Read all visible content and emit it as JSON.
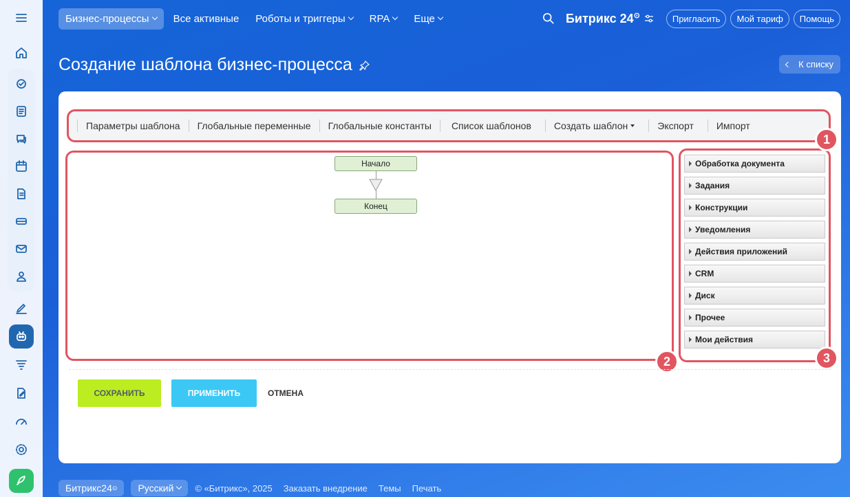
{
  "nav": {
    "items": [
      {
        "label": "Бизнес-процессы",
        "active": true,
        "dropdown": true
      },
      {
        "label": "Все активные",
        "active": false,
        "dropdown": false
      },
      {
        "label": "Роботы и триггеры",
        "active": false,
        "dropdown": true
      },
      {
        "label": "RPA",
        "active": false,
        "dropdown": true
      },
      {
        "label": "Еще",
        "active": false,
        "dropdown": true
      }
    ],
    "logo": "Битрикс 24",
    "invite": "Пригласить",
    "tariff": "Мой тариф",
    "help": "Помощь"
  },
  "page": {
    "title": "Создание шаблона бизнес-процесса",
    "back": "К списку"
  },
  "toolbar": {
    "items": [
      "Параметры шаблона",
      "Глобальные переменные",
      "Глобальные константы",
      "Список шаблонов",
      "Создать шаблон",
      "Экспорт",
      "Импорт"
    ]
  },
  "canvas": {
    "start": "Начало",
    "end": "Конец"
  },
  "palette": {
    "items": [
      "Обработка документа",
      "Задания",
      "Конструкции",
      "Уведомления",
      "Действия приложений",
      "CRM",
      "Диск",
      "Прочее",
      "Мои действия"
    ]
  },
  "badges": [
    "1",
    "2",
    "3"
  ],
  "actions": {
    "save": "СОХРАНИТЬ",
    "apply": "ПРИМЕНИТЬ",
    "cancel": "ОТМЕНА"
  },
  "footer": {
    "brand": "Битрикс24",
    "language": "Русский",
    "copyright": "© «Битрикс», 2025",
    "order": "Заказать внедрение",
    "themes": "Темы",
    "print": "Печать"
  },
  "sidebar_icons": [
    "menu-icon",
    "home-icon",
    "tasks-icon",
    "news-icon",
    "chat-icon",
    "calendar-icon",
    "document-icon",
    "drive-icon",
    "mail-icon",
    "contacts-icon",
    "sign-icon",
    "automation-icon",
    "filter-icon",
    "edit-icon",
    "speed-icon",
    "settings-icon",
    "rocket-icon"
  ]
}
